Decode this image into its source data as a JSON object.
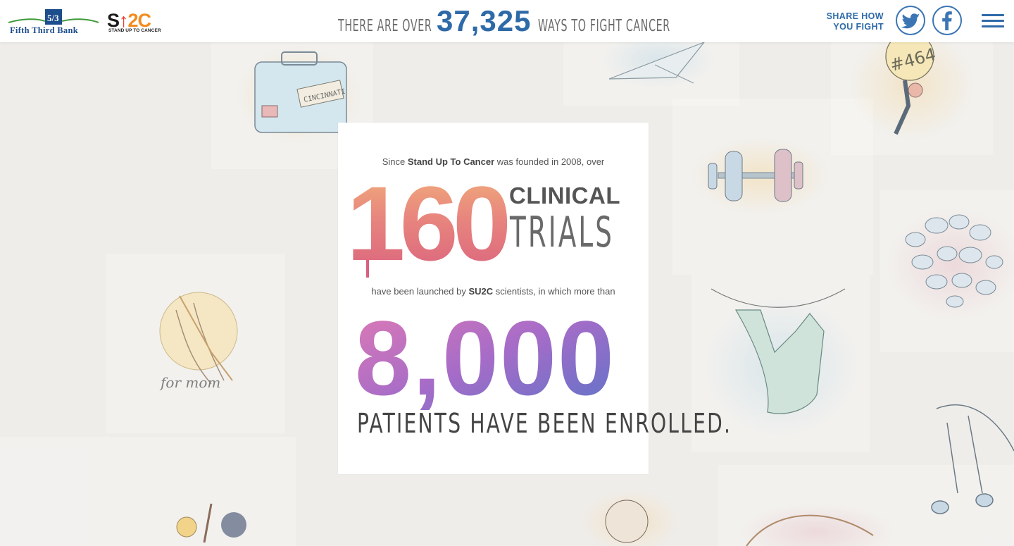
{
  "header": {
    "bank_logo_text": "Fifth Third Bank",
    "su2c_logo_text": "SU2C",
    "su2c_tagline": "STAND UP TO CANCER",
    "headline_prefix": "THERE ARE OVER",
    "headline_count": "37,325",
    "headline_suffix": "WAYS TO FIGHT CANCER",
    "share_line1": "SHARE HOW",
    "share_line2": "YOU FIGHT"
  },
  "icons": {
    "twitter": "twitter-icon",
    "facebook": "facebook-icon",
    "menu": "hamburger-menu-icon"
  },
  "colors": {
    "brand_blue": "#2f6aa8",
    "bank_green": "#3f9a3a",
    "su2c_red": "#e63323",
    "su2c_orange": "#f28c1e"
  },
  "card": {
    "intro_before": "Since ",
    "intro_bold": "Stand Up To Cancer",
    "intro_after": " was founded in 2008, over",
    "trials_number": "160",
    "trials_word1": "CLINICAL",
    "trials_word2": "TRIALS",
    "launched_before": "have been launched by ",
    "launched_bold": "SU2C",
    "launched_after": " scientists, in which more than",
    "patients_number": "8,000",
    "patients_caption": "PATIENTS HAVE BEEN ENROLLED."
  },
  "background": {
    "luggage_tag": "CINCINNATI",
    "sign_text": "#464",
    "praying_caption": "for mom"
  }
}
